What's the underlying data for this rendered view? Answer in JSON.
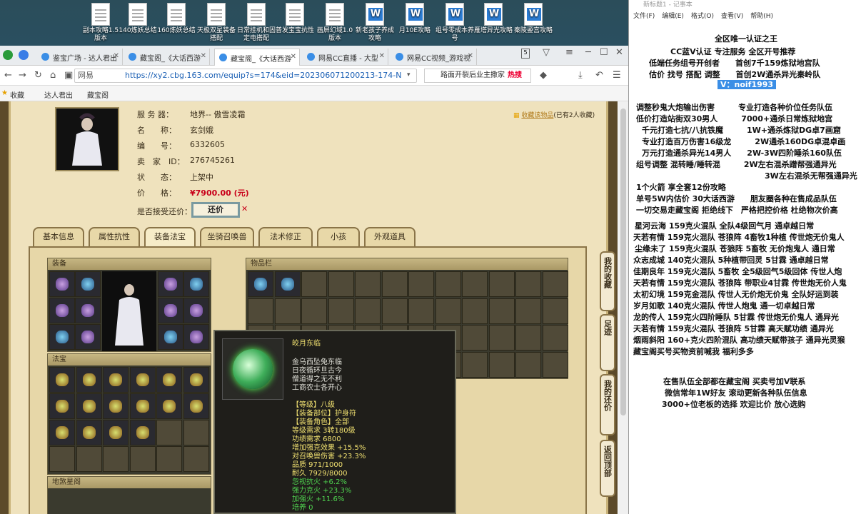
{
  "desktop": {
    "icons": [
      {
        "label": "副本攻略1.5版本",
        "type": "doc"
      },
      {
        "label": "140炼妖总结",
        "type": "doc"
      },
      {
        "label": "160炼妖总结",
        "type": "doc"
      },
      {
        "label": "天极双星装备搭配",
        "type": "doc"
      },
      {
        "label": "日常挂机和固定电搭配",
        "type": "doc"
      },
      {
        "label": "普发宝宝抗性",
        "type": "doc"
      },
      {
        "label": "画屏幻域1.0版本",
        "type": "doc"
      },
      {
        "label": "新老孩子养成攻略",
        "type": "word"
      },
      {
        "label": "月10E攻略",
        "type": "word"
      },
      {
        "label": "组号零成本养号",
        "type": "word"
      },
      {
        "label": "雁塔异光攻略",
        "type": "word"
      },
      {
        "label": "秦陵鎏宫攻略",
        "type": "word"
      }
    ]
  },
  "browser": {
    "tabs": [
      {
        "label": "鉴宝广场 - 达人君出",
        "active": false
      },
      {
        "label": "藏宝阁_《大话西游",
        "active": false
      },
      {
        "label": "藏宝阁_《大话西游",
        "active": true
      },
      {
        "label": "网易CC直播 - 大型",
        "active": false
      },
      {
        "label": "网易CC视频_游戏视",
        "active": false
      }
    ],
    "site_label": "网易",
    "url": "https://xy2.cbg.163.com/equip?s=174&eid=202306071200213-174-N",
    "search_placeholder": "路面开裂后业主撒家",
    "search_hot": "热搜",
    "bookmarks": [
      "收藏",
      "达人君出",
      "藏宝阁"
    ]
  },
  "listing": {
    "server_label": "服 务 器：",
    "server": "地界-- 傲雪凌霜",
    "name_label": "名　　称：",
    "name": "玄剑娥",
    "id_label": "编　　号：",
    "id": "6332605",
    "seller_label": "卖　家　ID：",
    "seller_id": "276745261",
    "status_label": "状　　态：",
    "status": "上架中",
    "price_label": "价　　格：",
    "price": "¥7900.00 (元)",
    "haggle_label": "是否接受还价：",
    "haggle_button": "还价",
    "haggle_x": "✕",
    "fav_link": "收藏该物品",
    "fav_count": "(已有2人收藏)"
  },
  "tabs": [
    "基本信息",
    "属性抗性",
    "装备法宝",
    "坐骑召唤兽",
    "法术修正",
    "小孩",
    "外观道具"
  ],
  "active_tab": 2,
  "sections": {
    "equip": "装备",
    "fabao": "法宝",
    "dijia": "地煞星阁",
    "items": "物品栏"
  },
  "side_nav": [
    "我的收藏",
    "足迹",
    "我的还价",
    "返回顶部"
  ],
  "tooltip": {
    "name": "皎月东临",
    "desc": [
      "金乌西坠兔东临",
      "日夜循环旦古今",
      "僧道得之无不利",
      "工商农士各开心"
    ],
    "stats": [
      {
        "text": "【等级】八级",
        "color": "#f0e070"
      },
      {
        "text": "【装备部位】护身符",
        "color": "#f0e070"
      },
      {
        "text": "【装备角色】全部",
        "color": "#f0e070"
      },
      {
        "text": "等级需求 3转180级",
        "color": "#f0e070"
      },
      {
        "text": "功绩需求 6800",
        "color": "#f0e070"
      },
      {
        "text": "增加强克效果 +15.5%",
        "color": "#f0e070"
      },
      {
        "text": "对召唤兽伤害 +23.3%",
        "color": "#f0e070"
      },
      {
        "text": "品质 971/1000",
        "color": "#f0e070"
      },
      {
        "text": "耐久 7929/8000",
        "color": "#f0e070"
      },
      {
        "text": "忽视抗火 +6.2%",
        "color": "#4fd24f"
      },
      {
        "text": "强力克火 +23.3%",
        "color": "#4fd24f"
      },
      {
        "text": "加强火 +11.6%",
        "color": "#4fd24f"
      },
      {
        "text": "培养 0",
        "color": "#4fd24f"
      }
    ]
  },
  "notepad": {
    "title": "新标题1 - 记事本",
    "menu": [
      "文件(F)",
      "编辑(E)",
      "格式(O)",
      "查看(V)",
      "帮助(H)"
    ],
    "lines": [
      "全区唯一认证之王",
      "CC蓝V认证 专注服务 全区开号推荐",
      "低端任务组号开创者　　首创7千159炼狱地宫队",
      "估价 找号 搭配 调整　　首创2W通杀异光秦岭队",
      "V：noif1993",
      "调整秒鬼大炮输出伤害　　　专业打造各种价位任务队伍",
      "低价打造站街双30男人　　　7000+通杀日常炼狱地宫",
      "千元打造七抗/八抗铁魔　　　1W+通杀炼狱DG卓7画窟",
      "专业打造百万伤害16级龙　　　2W通杀160DG卓混卓画",
      "万元打造通杀异光14男人　　2W-3W四阶睡杀160队伍",
      "组号调整 混转睡/睡转混　　　2W左右混杀蹭帮强通异光",
      "3W左右混杀无帮强通异光",
      "1个火箭 享全套12份攻略",
      "单号5W内估价 30大话西游　　朋友圈各种在售成品队伍",
      "一切交易走藏宝阁 拒绝线下　严格把控价格 杜绝物次价高",
      "星河云海 159克火混队 全队4级回气月 通卓越日常",
      "天若有情 159克火混队 苍狼阵 4畜牧1种植 传世炮无价鬼人",
      "尘缘未了 159克火混队 苍狼阵 5畜牧 无价炮鬼人 通日常",
      "众志成城 140克火混队 5种植带回灵 5甘霖 通卓越日常",
      "佳期良年 159克火混队 5畜牧 全5级回气5级回体 传世人炮",
      "天若有情 159克火混队 苍狼阵 带职业4甘霖 传世炮无价人鬼",
      "太初幻境 159克金混队 传世人无价炮无价鬼 全队好运到装",
      "岁月如歌 140克火混队 传世人炮鬼 通一切卓越日常",
      "龙的传人 159克火四阶睡队 5甘霖 传世炮无价鬼人 通异光",
      "天若有情 159克火混队 苍狼阵 5甘霖 高天赋功绩 通异光",
      "烟雨斜阳 160+克火四阶混队 高功绩天赋带孩子 通异光灵猴",
      "藏宝阁买号买物资前喊我 福利多多",
      "在售队伍全部都在藏宝阁 买卖号加V联系",
      "微信常年1W好友 滚动更新各种队伍信息",
      "3000+位老板的选择 欢迎比价 放心选购"
    ]
  }
}
